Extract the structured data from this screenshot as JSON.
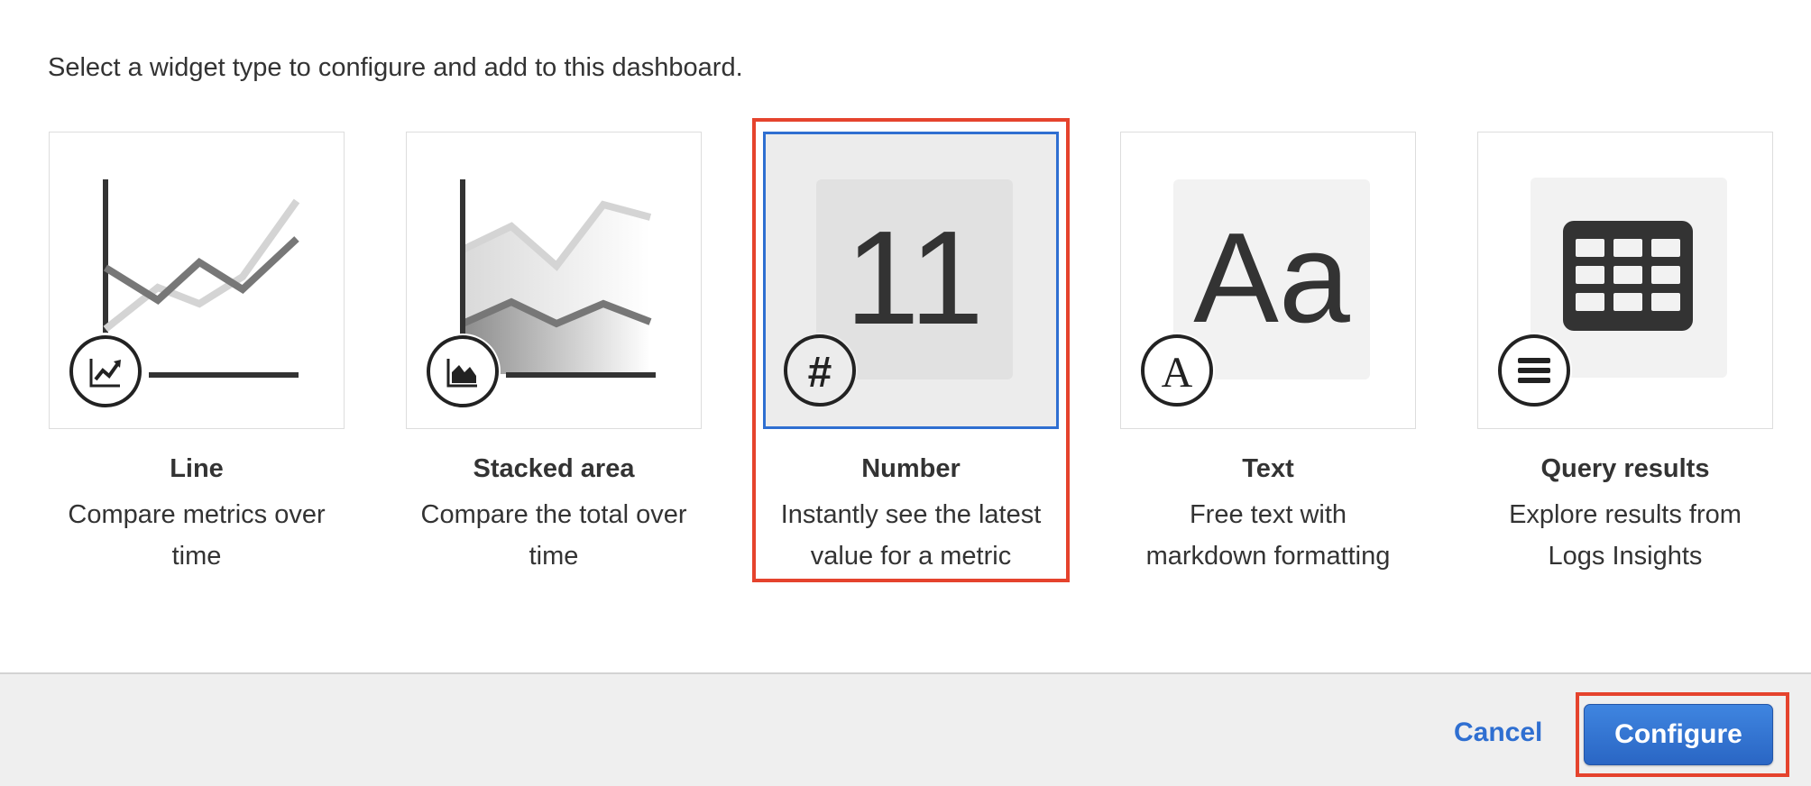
{
  "instruction": "Select a widget type to configure and add to this dashboard.",
  "widgets": [
    {
      "title": "Line",
      "description_lines": [
        "Compare metrics over",
        "time"
      ],
      "icon": "line-chart-icon",
      "selected": false
    },
    {
      "title": "Stacked area",
      "description_lines": [
        "Compare the total over",
        "time"
      ],
      "icon": "area-chart-icon",
      "selected": false
    },
    {
      "title": "Number",
      "description_lines": [
        "Instantly see the latest",
        "value for a metric"
      ],
      "icon": "hash-icon",
      "preview_value": "11",
      "badge_glyph": "#",
      "selected": true
    },
    {
      "title": "Text",
      "description_lines": [
        "Free text with",
        "markdown formatting"
      ],
      "icon": "text-icon",
      "preview_text": "Aa",
      "badge_glyph": "A",
      "selected": false
    },
    {
      "title": "Query results",
      "description_lines": [
        "Explore results from",
        "Logs Insights"
      ],
      "icon": "list-icon",
      "selected": false
    }
  ],
  "footer": {
    "cancel_label": "Cancel",
    "configure_label": "Configure"
  },
  "colors": {
    "accent": "#2f6fd1",
    "highlight": "#e5432d",
    "selected_bg": "#ececec"
  }
}
